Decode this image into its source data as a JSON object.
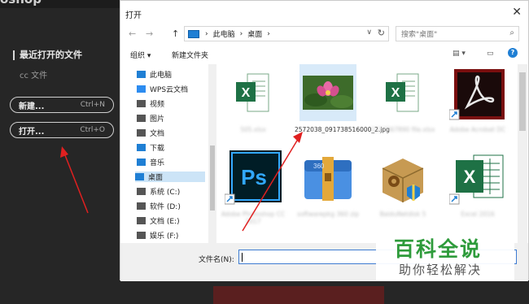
{
  "app": {
    "title_fragment": "oshop"
  },
  "ps_home": {
    "recent_label": "最近打开的文件",
    "cc_label": "cc 文件",
    "new_btn": {
      "label": "新建...",
      "shortcut": "Ctrl+N"
    },
    "open_btn": {
      "label": "打开...",
      "shortcut": "Ctrl+O"
    }
  },
  "dialog": {
    "title": "打开",
    "close": "✕",
    "address": {
      "back": "←",
      "forward": "→",
      "up": "↑",
      "crumbs": [
        "此电脑",
        "桌面"
      ],
      "sep": "›",
      "dropdown": "∨",
      "refresh": "↻"
    },
    "search": {
      "placeholder": "搜索\"桌面\"",
      "icon": "⌕"
    },
    "toolbar": {
      "organize": "组织 ▾",
      "new_folder": "新建文件夹",
      "view_icon": "▤ ▾",
      "pane_icon": "▭",
      "help_icon": "?"
    },
    "sidebar": [
      {
        "label": "此电脑",
        "icon": "computer-icon",
        "color": "#1f7fd4"
      },
      {
        "label": "WPS云文档",
        "icon": "cloud-icon",
        "color": "#2d8cf0"
      },
      {
        "label": "视频",
        "icon": "video-icon",
        "color": "#555555"
      },
      {
        "label": "图片",
        "icon": "picture-icon",
        "color": "#555555"
      },
      {
        "label": "文档",
        "icon": "document-icon",
        "color": "#555555"
      },
      {
        "label": "下载",
        "icon": "download-icon",
        "color": "#1f7fd4"
      },
      {
        "label": "音乐",
        "icon": "music-icon",
        "color": "#1f7fd4"
      },
      {
        "label": "桌面",
        "icon": "desktop-icon",
        "color": "#1f7fd4",
        "selected": true
      },
      {
        "label": "系统 (C:)",
        "icon": "drive-icon",
        "color": "#555555"
      },
      {
        "label": "软件 (D:)",
        "icon": "drive-icon",
        "color": "#555555"
      },
      {
        "label": "文档 (E:)",
        "icon": "drive-icon",
        "color": "#555555"
      },
      {
        "label": "娱乐 (F:)",
        "icon": "drive-icon",
        "color": "#555555"
      }
    ],
    "files": [
      {
        "icon": "excel-icon",
        "caption": "505.xlsx",
        "blurred": true
      },
      {
        "icon": "image-thumb-icon",
        "caption": "2572038_091738516000_2.jpg",
        "blurred": false,
        "selected": true
      },
      {
        "icon": "excel-icon",
        "caption": "1234567890 file.xlsx",
        "blurred": true
      },
      {
        "icon": "acrobat-icon",
        "caption": "Adobe Acrobat DC",
        "blurred": true
      },
      {
        "icon": "photoshop-icon",
        "caption": "Adobe Photoshop CC 2017",
        "blurred": true
      },
      {
        "icon": "archive-icon",
        "caption": "softwarepkg 360 zip",
        "blurred": true
      },
      {
        "icon": "package-icon",
        "caption": "BaiduNetdisk 5",
        "blurred": true
      },
      {
        "icon": "excel-icon",
        "caption": "Excel 2016",
        "blurred": true
      }
    ],
    "footer": {
      "filename_label": "文件名(N):",
      "filename_value": ""
    }
  },
  "watermark": {
    "big": "百科全说",
    "small": "助你轻松解决"
  }
}
